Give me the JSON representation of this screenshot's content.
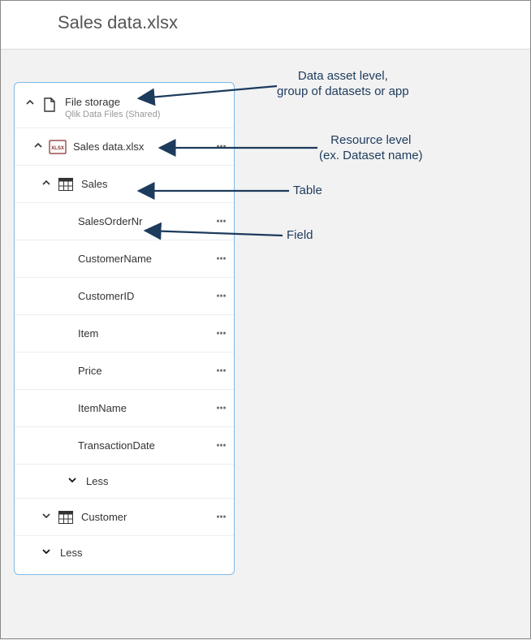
{
  "header": {
    "title": "Sales data.xlsx"
  },
  "panel": {
    "data_asset": {
      "label": "File storage",
      "sublabel": "Qlik Data Files (Shared)"
    },
    "resource": {
      "label": "Sales data.xlsx"
    },
    "tables": [
      {
        "label": "Sales",
        "fields": [
          {
            "label": "SalesOrderNr"
          },
          {
            "label": "CustomerName"
          },
          {
            "label": "CustomerID"
          },
          {
            "label": "Item"
          },
          {
            "label": "Price"
          },
          {
            "label": "ItemName"
          },
          {
            "label": "TransactionDate"
          }
        ],
        "less_label": "Less"
      },
      {
        "label": "Customer"
      }
    ],
    "bottom_less_label": "Less"
  },
  "annotations": {
    "data_asset": "Data asset level,\ngroup of datasets or app",
    "resource": "Resource level\n(ex. Dataset name)",
    "table": "Table",
    "field": "Field"
  }
}
